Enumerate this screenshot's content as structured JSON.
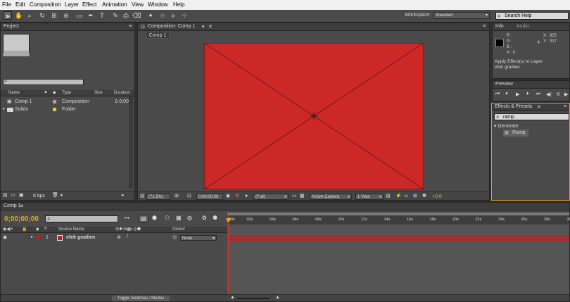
{
  "menu": [
    "File",
    "Edit",
    "Composition",
    "Layer",
    "Effect",
    "Animation",
    "View",
    "Window",
    "Help"
  ],
  "toolbar": {
    "workspace_label": "Workspace:",
    "workspace_value": "Standard",
    "search_placeholder": "Search Help"
  },
  "project": {
    "tab": "Project",
    "columns": {
      "name": "Name",
      "type": "Type",
      "size": "Size",
      "duration": "Duration"
    },
    "items": [
      {
        "name": "Comp 1",
        "type": "Composition",
        "duration": "Δ 0;00",
        "swatch": "#c79a9a"
      },
      {
        "name": "Solids",
        "type": "Folder",
        "duration": "",
        "swatch": "#e6c63a"
      }
    ],
    "bpc": "8 bpc"
  },
  "composition": {
    "tab": "Composition: Comp 1",
    "subtab": "Comp 1",
    "solid_color": "#cc2828",
    "zoom": "(71.5%)",
    "timecode": "0;00;00;00",
    "resolution": "(Full)",
    "camera": "Active Camera",
    "view": "1 View",
    "exposure": "+0.0"
  },
  "info": {
    "tabs": [
      "Info",
      "Audio"
    ],
    "r": "R :",
    "g": "G :",
    "b": "B :",
    "a": "A :  0",
    "x": "X : 925",
    "y": "Y : 317",
    "message_1": "Apply Effect(s) to Layer:",
    "message_2": "efek gradien"
  },
  "preview": {
    "tab": "Preview"
  },
  "effects": {
    "tab": "Effects & Presets",
    "search": "ramp",
    "category": "Generate",
    "item": "Ramp"
  },
  "timeline": {
    "tab": "Comp 1",
    "timecode": "0;00;00;00",
    "ruler": [
      "00s",
      "02s",
      "04s",
      "06s",
      "08s",
      "10s",
      "12s",
      "14s",
      "16s",
      "18s",
      "20s",
      "22s",
      "24s",
      "26s",
      "28s",
      "30s"
    ],
    "headers": {
      "source": "Source Name",
      "parent": "Parent"
    },
    "layer": {
      "index": "1",
      "name": "efek gradien",
      "parent": "None",
      "color": "#b52020"
    },
    "toggle": "Toggle Switches / Modes"
  }
}
